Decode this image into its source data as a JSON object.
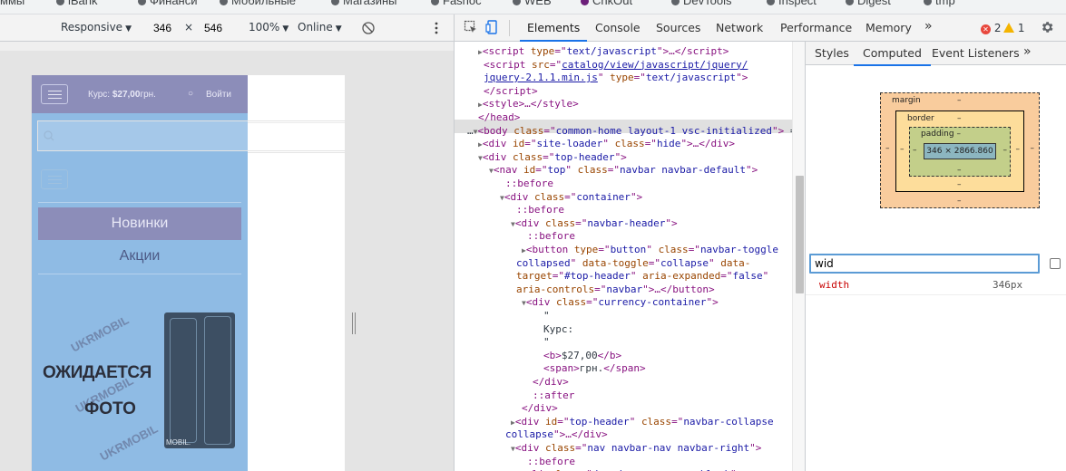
{
  "bookmarks": {
    "items": [
      "ммы",
      "iBank",
      "Финанси",
      "Мобильные",
      "Магазины",
      "Fashoc",
      "WEB",
      "ChkOut",
      "DevTools",
      "Inspect",
      "Digest",
      "tmp"
    ]
  },
  "device_toolbar": {
    "device": "Responsive",
    "width": "346",
    "times": "×",
    "height": "546",
    "zoom": "100%",
    "throttle": "Online"
  },
  "page": {
    "currency_label": "Курс:",
    "currency_value": "$27,00",
    "currency_unit": "грн.",
    "login": "Войти",
    "menu_new": "Новинки",
    "menu_sale": "Акции",
    "awaiting": "ОЖИДАЕТСЯ",
    "photo": "ФОТО",
    "watermark": "UKRMOBIL",
    "product_brand": "MOBIL."
  },
  "devtools": {
    "tabs": [
      "Elements",
      "Console",
      "Sources",
      "Network",
      "Performance",
      "Memory"
    ],
    "more": "»",
    "errors": "2",
    "warnings": "1",
    "colors": {
      "accent": "#1a73e8",
      "error": "#e8473c",
      "warning": "#f4b400"
    }
  },
  "elements_tree": {
    "lines": [
      {
        "indent": 2,
        "html": "<span class='ar'>▶</span>&lt;script <span class='an'>type</span>=\"<span class='av'>text/javascript</span>\"&gt;…&lt;/script&gt;"
      },
      {
        "indent": 3,
        "html": "&lt;script <span class='an'>src</span>=\"<span class='lk'>catalog/view/javascript/jquery/</span>"
      },
      {
        "indent": 3,
        "html": "<span class='lk'>jquery-2.1.1.min.js</span>\" <span class='an'>type</span>=\"<span class='av'>text/javascript</span>\"&gt;"
      },
      {
        "indent": 3,
        "html": "&lt;/script&gt;"
      },
      {
        "indent": 2,
        "html": "<span class='ar'>▶</span>&lt;style&gt;…&lt;/style&gt;"
      },
      {
        "indent": 2,
        "html": "&lt;/head&gt;"
      },
      {
        "indent": 0,
        "html": "<span class='tx'>…</span><span class='ar'>▼</span>&lt;body <span class='an'>class</span>=\"<span class='av'>common-home layout-1 vsc-initialized</span>\"&gt; <span class='tx'>=</span>"
      },
      {
        "indent": 2,
        "html": "<span class='ar'>▶</span>&lt;div <span class='an'>id</span>=\"<span class='av'>site-loader</span>\" <span class='an'>class</span>=\"<span class='av'>hide</span>\"&gt;…&lt;/div&gt;"
      },
      {
        "indent": 2,
        "html": "<span class='ar'>▼</span>&lt;div <span class='an'>class</span>=\"<span class='av'>top-header</span>\"&gt;"
      },
      {
        "indent": 4,
        "html": "<span class='ar'>▼</span>&lt;nav <span class='an'>id</span>=\"<span class='av'>top</span>\" <span class='an'>class</span>=\"<span class='av'>navbar navbar-default</span>\"&gt;"
      },
      {
        "indent": 7,
        "html": "<span class='ps'>::before</span>"
      },
      {
        "indent": 6,
        "html": "<span class='ar'>▼</span>&lt;div <span class='an'>class</span>=\"<span class='av'>container</span>\"&gt;"
      },
      {
        "indent": 9,
        "html": "<span class='ps'>::before</span>"
      },
      {
        "indent": 8,
        "html": "<span class='ar'>▼</span>&lt;div <span class='an'>class</span>=\"<span class='av'>navbar-header</span>\"&gt;"
      },
      {
        "indent": 11,
        "html": "<span class='ps'>::before</span>"
      },
      {
        "indent": 10,
        "html": "<span class='ar'>▶</span>&lt;button <span class='an'>type</span>=\"<span class='av'>button</span>\" <span class='an'>class</span>=\"<span class='av'>navbar-toggle</span>"
      },
      {
        "indent": 9,
        "html": "<span class='av'>collapsed</span>\" <span class='an'>data-toggle</span>=\"<span class='av'>collapse</span>\" <span class='an'>data-</span>"
      },
      {
        "indent": 9,
        "html": "<span class='an'>target</span>=\"<span class='av'>#top-header</span>\" <span class='an'>aria-expanded</span>=\"<span class='av'>false</span>\""
      },
      {
        "indent": 9,
        "html": "<span class='an'>aria-controls</span>=\"<span class='av'>navbar</span>\"&gt;…&lt;/button&gt;"
      },
      {
        "indent": 10,
        "html": "<span class='ar'>▼</span>&lt;div <span class='an'>class</span>=\"<span class='av'>currency-container</span>\"&gt;"
      },
      {
        "indent": 14,
        "html": "<span class='tx'>\"</span>"
      },
      {
        "indent": 14,
        "html": "<span class='tx'>Курс:</span>"
      },
      {
        "indent": 14,
        "html": "<span class='tx'>\"</span>"
      },
      {
        "indent": 14,
        "html": "&lt;b&gt;<span class='tx'>$27,00</span>&lt;/b&gt;"
      },
      {
        "indent": 14,
        "html": "&lt;span&gt;<span class='tx'>грн.</span>&lt;/span&gt;"
      },
      {
        "indent": 12,
        "html": "&lt;/div&gt;"
      },
      {
        "indent": 12,
        "html": "<span class='ps'>::after</span>"
      },
      {
        "indent": 10,
        "html": "&lt;/div&gt;"
      },
      {
        "indent": 8,
        "html": "<span class='ar'>▶</span>&lt;div <span class='an'>id</span>=\"<span class='av'>top-header</span>\" <span class='an'>class</span>=\"<span class='av'>navbar-collapse</span>"
      },
      {
        "indent": 7,
        "html": "<span class='av'>collapse</span>\"&gt;…&lt;/div&gt;"
      },
      {
        "indent": 8,
        "html": "<span class='ar'>▼</span>&lt;div <span class='an'>class</span>=\"<span class='av'>nav navbar-nav navbar-right</span>\"&gt;"
      },
      {
        "indent": 11,
        "html": "<span class='ps'>::before</span>"
      },
      {
        "indent": 10,
        "html": "<span class='ar'>▶</span>&lt;li <span class='an'>class</span>=\"<span class='av'>dropdown currency-block</span>\"&gt;"
      }
    ]
  },
  "side_pane": {
    "tabs": [
      "Styles",
      "Computed",
      "Event Listeners"
    ],
    "more": "»",
    "box_model": {
      "margin": "margin",
      "border": "border",
      "padding": "padding",
      "dash": "–",
      "content": "346 × 2866.860"
    },
    "filter_value": "wid",
    "property": {
      "name": "width",
      "value": "346px"
    }
  }
}
